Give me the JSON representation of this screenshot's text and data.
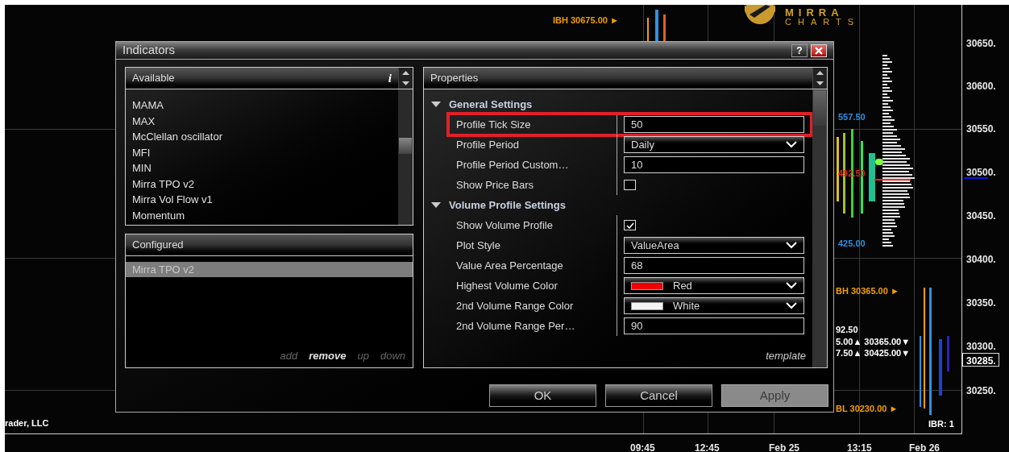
{
  "chart": {
    "logo": {
      "line1": "MIRRA",
      "line2": "CHARTS"
    },
    "price_labels": [
      "30650.",
      "30600.",
      "30550.",
      "30500.",
      "30450.",
      "30400.",
      "30350.",
      "30300.",
      "30250."
    ],
    "current_price": "30285.",
    "time_labels": [
      "09:45",
      "12:45",
      "Feb 25",
      "13:15",
      "Feb 26"
    ],
    "annotations": [
      {
        "text": "IBH 30675.00 ►",
        "color": "#f0a000"
      },
      {
        "text": "557.50",
        "color": "#3090e0"
      },
      {
        "text": "492.50",
        "color": "#e02020"
      },
      {
        "text": "425.00",
        "color": "#3090e0"
      },
      {
        "text": "BH 30365.00 ►",
        "color": "#f0a000"
      },
      {
        "text": "92.50",
        "color": "#ffffff"
      },
      {
        "text": "5.00▲ 30365.00▼",
        "color": "#ffffff"
      },
      {
        "text": "7.50▲ 30425.00▼",
        "color": "#ffffff"
      },
      {
        "text": "BL 30230.00 ►",
        "color": "#f0a000"
      },
      {
        "text": "IBR: 1",
        "color": "#ffffff"
      }
    ],
    "footer": "rader, LLC"
  },
  "dialog": {
    "title": "Indicators",
    "help": "?",
    "available": {
      "title": "Available",
      "info": "i",
      "items": [
        {
          "label": "MAMA"
        },
        {
          "label": "MAX"
        },
        {
          "label": "McClellan oscillator"
        },
        {
          "label": "MFI"
        },
        {
          "label": "MIN"
        },
        {
          "label": "Mirra TPO v2"
        },
        {
          "label": "Mirra Vol Flow v1"
        },
        {
          "label": "Momentum"
        }
      ]
    },
    "configured": {
      "title": "Configured",
      "items": [
        {
          "label": "Mirra TPO v2",
          "selected": true
        }
      ],
      "actions": [
        {
          "label": "add",
          "disabled": true
        },
        {
          "label": "remove",
          "disabled": false
        },
        {
          "label": "up",
          "disabled": true
        },
        {
          "label": "down",
          "disabled": true
        }
      ]
    },
    "properties": {
      "title": "Properties",
      "template": "template",
      "rows": [
        {
          "kind": "section",
          "label": "General Settings",
          "expanded": true
        },
        {
          "kind": "text",
          "label": "Profile Tick Size",
          "value": "50",
          "highlighted": true
        },
        {
          "kind": "dropdown",
          "label": "Profile Period",
          "value": "Daily"
        },
        {
          "kind": "text",
          "label": "Profile Period Custom…",
          "value": "10"
        },
        {
          "kind": "checkbox",
          "label": "Show Price Bars",
          "checked": false
        },
        {
          "kind": "section",
          "label": "Volume Profile Settings",
          "expanded": true
        },
        {
          "kind": "checkbox",
          "label": "Show Volume Profile",
          "checked": true
        },
        {
          "kind": "dropdown",
          "label": "Plot Style",
          "value": "ValueArea"
        },
        {
          "kind": "text",
          "label": "Value Area Percentage",
          "value": "68"
        },
        {
          "kind": "color",
          "label": "Highest Volume Color",
          "value": "Red",
          "color": "#ee0000"
        },
        {
          "kind": "color",
          "label": "2nd Volume Range Color",
          "value": "White",
          "color": "#f4f4f4"
        },
        {
          "kind": "text",
          "label": "2nd Volume Range Per…",
          "value": "90"
        }
      ]
    },
    "buttons": [
      {
        "label": "OK",
        "disabled": false
      },
      {
        "label": "Cancel",
        "disabled": false
      },
      {
        "label": "Apply",
        "disabled": true
      }
    ]
  }
}
